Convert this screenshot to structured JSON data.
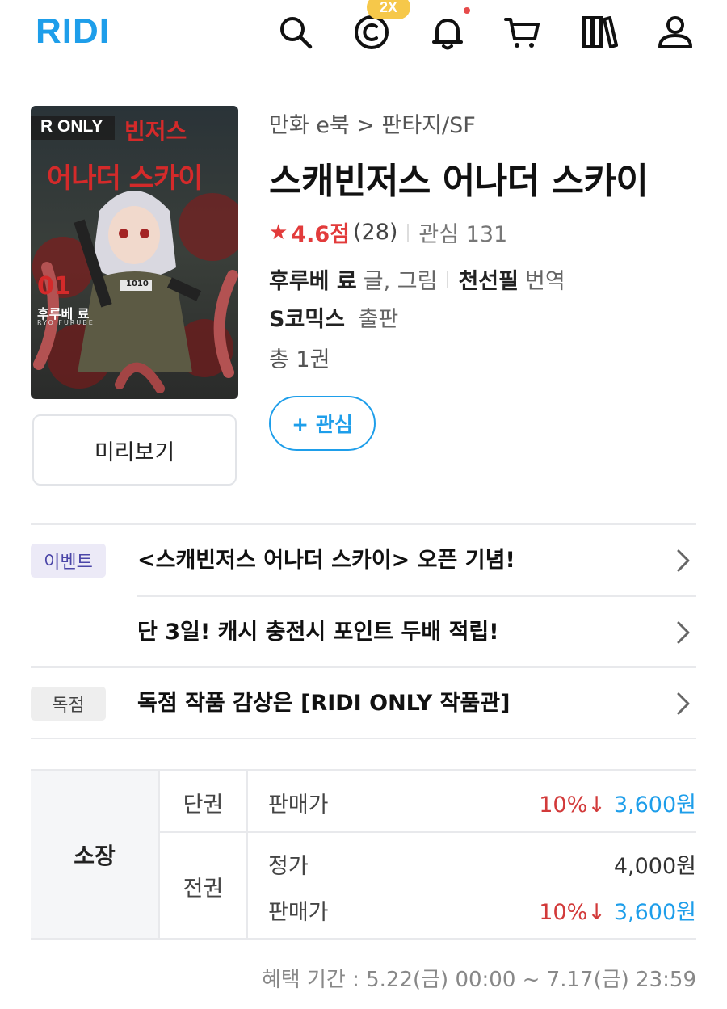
{
  "header": {
    "logo": "RIDI",
    "badge_2x": "2X",
    "colors": {
      "brand": "#1e9eea",
      "badge": "#f6c84a",
      "notification": "#e64b4b"
    },
    "icons": [
      "search-icon",
      "cash-icon",
      "bell-icon",
      "cart-icon",
      "library-icon",
      "user-icon"
    ]
  },
  "book": {
    "cover": {
      "badge": "R ONLY",
      "title_line1": "빈저스",
      "title_line2": "어나더 스카이",
      "volume": "01",
      "author": "후루베 료",
      "author_en": "RYO FURUBE",
      "number": "1010"
    },
    "breadcrumb": "만화 e북 > 판타지/SF",
    "title": "스캐빈저스 어나더 스카이",
    "rating_score": "4.6점",
    "rating_count": "(28)",
    "interest": "관심 131",
    "author_name": "후루베 료",
    "author_role": "글, 그림",
    "translator_name": "천선필",
    "translator_role": "번역",
    "publisher_name": "S코믹스",
    "publisher_role": "출판",
    "volumes": "총 1권",
    "preview_label": "미리보기",
    "favorite_label": "+ 관심"
  },
  "events": [
    {
      "badge": "이벤트",
      "text": "<스캐빈저스 어나더 스카이> 오픈 기념!"
    },
    {
      "badge": "",
      "text": "단 3일! 캐시 충전시 포인트 두배 적립!"
    },
    {
      "badge": "독점",
      "text": "독점 작품 감상은 [RIDI ONLY 작품관]"
    }
  ],
  "pricing": {
    "section_label": "소장",
    "single": {
      "category": "단권",
      "label": "판매가",
      "discount": "10%↓",
      "price": "3,600원"
    },
    "full": {
      "category": "전권",
      "list_label": "정가",
      "list_price": "4,000원",
      "sale_label": "판매가",
      "discount": "10%↓",
      "price": "3,600원"
    },
    "benefit_period": "혜택 기간 : 5.22(금) 00:00 ~ 7.17(금) 23:59"
  }
}
